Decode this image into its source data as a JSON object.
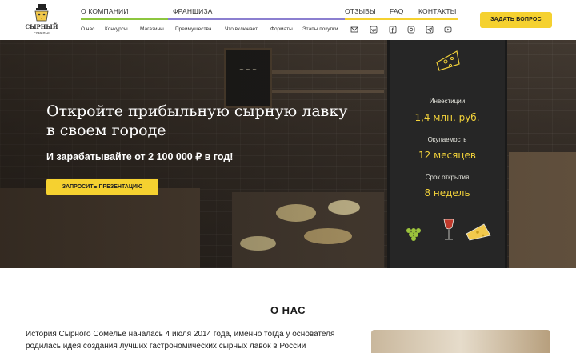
{
  "logo": {
    "name": "СЫРНЫЙ",
    "sub": "сомелье",
    "icon": "cheese-sommelier-mascot-icon"
  },
  "nav_top": [
    {
      "label": "О КОМПАНИИ"
    },
    {
      "label": "ФРАНШИЗА"
    },
    {
      "label": "ОТЗЫВЫ"
    },
    {
      "label": "FAQ"
    },
    {
      "label": "КОНТАКТЫ"
    }
  ],
  "nav_sub": [
    "О нас",
    "Конкурсы",
    "Магазины",
    "Преимущества",
    "Что включает",
    "Форматы",
    "Этапы покупки"
  ],
  "social_icons": [
    "mail-icon",
    "vk-icon",
    "facebook-icon",
    "instagram-icon",
    "telegram-icon",
    "youtube-icon"
  ],
  "header": {
    "ask_button": "ЗАДАТЬ ВОПРОС"
  },
  "colors": {
    "accent": "#f5d130",
    "bar_green": "#8dc63f",
    "bar_purple": "#8b7fd0",
    "bar_yellow": "#f5d130"
  },
  "hero": {
    "title": "Откройте прибыльную сырную лавку в своем городе",
    "subtitle": "И зарабатывайте от 2 100 000 ₽ в год!",
    "button": "ЗАПРОСИТЬ ПРЕЗЕНТАЦИЮ",
    "board": [
      {
        "label": "Инвестиции",
        "value": "1,4 млн. руб."
      },
      {
        "label": "Окупаемость",
        "value": "12 месяцев"
      },
      {
        "label": "Срок открытия",
        "value": "8 недель"
      }
    ]
  },
  "about": {
    "title": "О НАС",
    "text": "История Сырного Сомелье началась 4 июля 2014 года, именно тогда у основателя родилась идея создания лучших гастрономических сырных лавок в России"
  }
}
